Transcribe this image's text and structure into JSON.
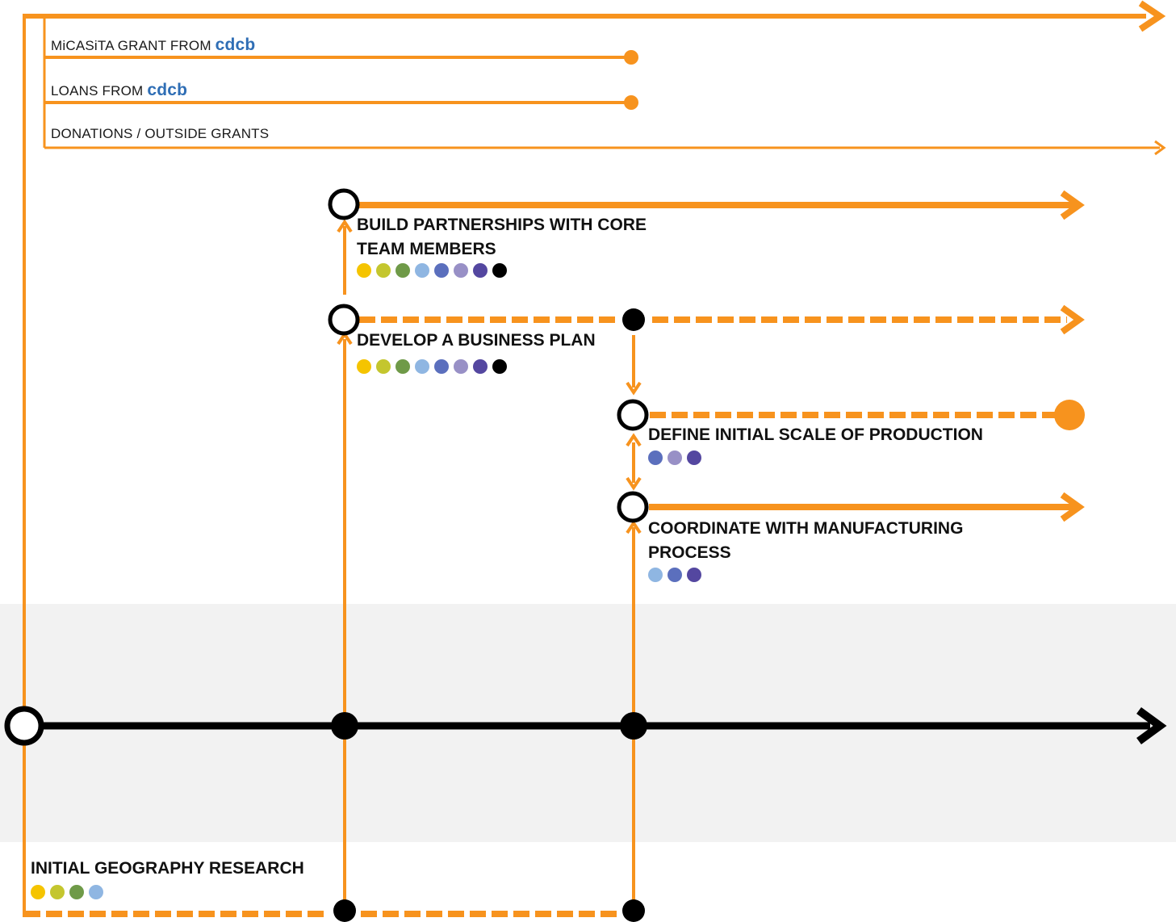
{
  "colors": {
    "orange": "#f7931e",
    "black": "#000000",
    "band": "#f2f2f2",
    "brand_blue": "#2f6eb5"
  },
  "dot_palette": [
    "#f5c400",
    "#c4c62e",
    "#6f9a48",
    "#8fb6e2",
    "#5b6fbd",
    "#9890c6",
    "#5447a0",
    "#000000"
  ],
  "funding": [
    {
      "label": "MiCASiTA GRANT FROM ",
      "brand": "cdcb",
      "end": "dot"
    },
    {
      "label": "LOANS FROM ",
      "brand": "cdcb",
      "end": "dot"
    },
    {
      "label": "DONATIONS / OUTSIDE GRANTS",
      "brand": "",
      "end": "arrow"
    }
  ],
  "tasks": {
    "partnerships": {
      "title_line1": "BUILD PARTNERSHIPS WITH CORE",
      "title_line2": "TEAM MEMBERS",
      "dots": [
        "#f5c400",
        "#c4c62e",
        "#6f9a48",
        "#8fb6e2",
        "#5b6fbd",
        "#9890c6",
        "#5447a0",
        "#000000"
      ]
    },
    "business_plan": {
      "title": "DEVELOP A BUSINESS PLAN",
      "dots": [
        "#f5c400",
        "#c4c62e",
        "#6f9a48",
        "#8fb6e2",
        "#5b6fbd",
        "#9890c6",
        "#5447a0",
        "#000000"
      ]
    },
    "scale": {
      "title": "DEFINE INITIAL SCALE OF PRODUCTION",
      "dots": [
        "#5b6fbd",
        "#9890c6",
        "#5447a0"
      ]
    },
    "manufacturing": {
      "title_line1": "COORDINATE WITH MANUFACTURING",
      "title_line2": "PROCESS",
      "dots": [
        "#8fb6e2",
        "#5b6fbd",
        "#5447a0"
      ]
    },
    "geography": {
      "title": "INITIAL GEOGRAPHY RESEARCH",
      "dots": [
        "#f5c400",
        "#c4c62e",
        "#6f9a48",
        "#8fb6e2"
      ]
    }
  }
}
